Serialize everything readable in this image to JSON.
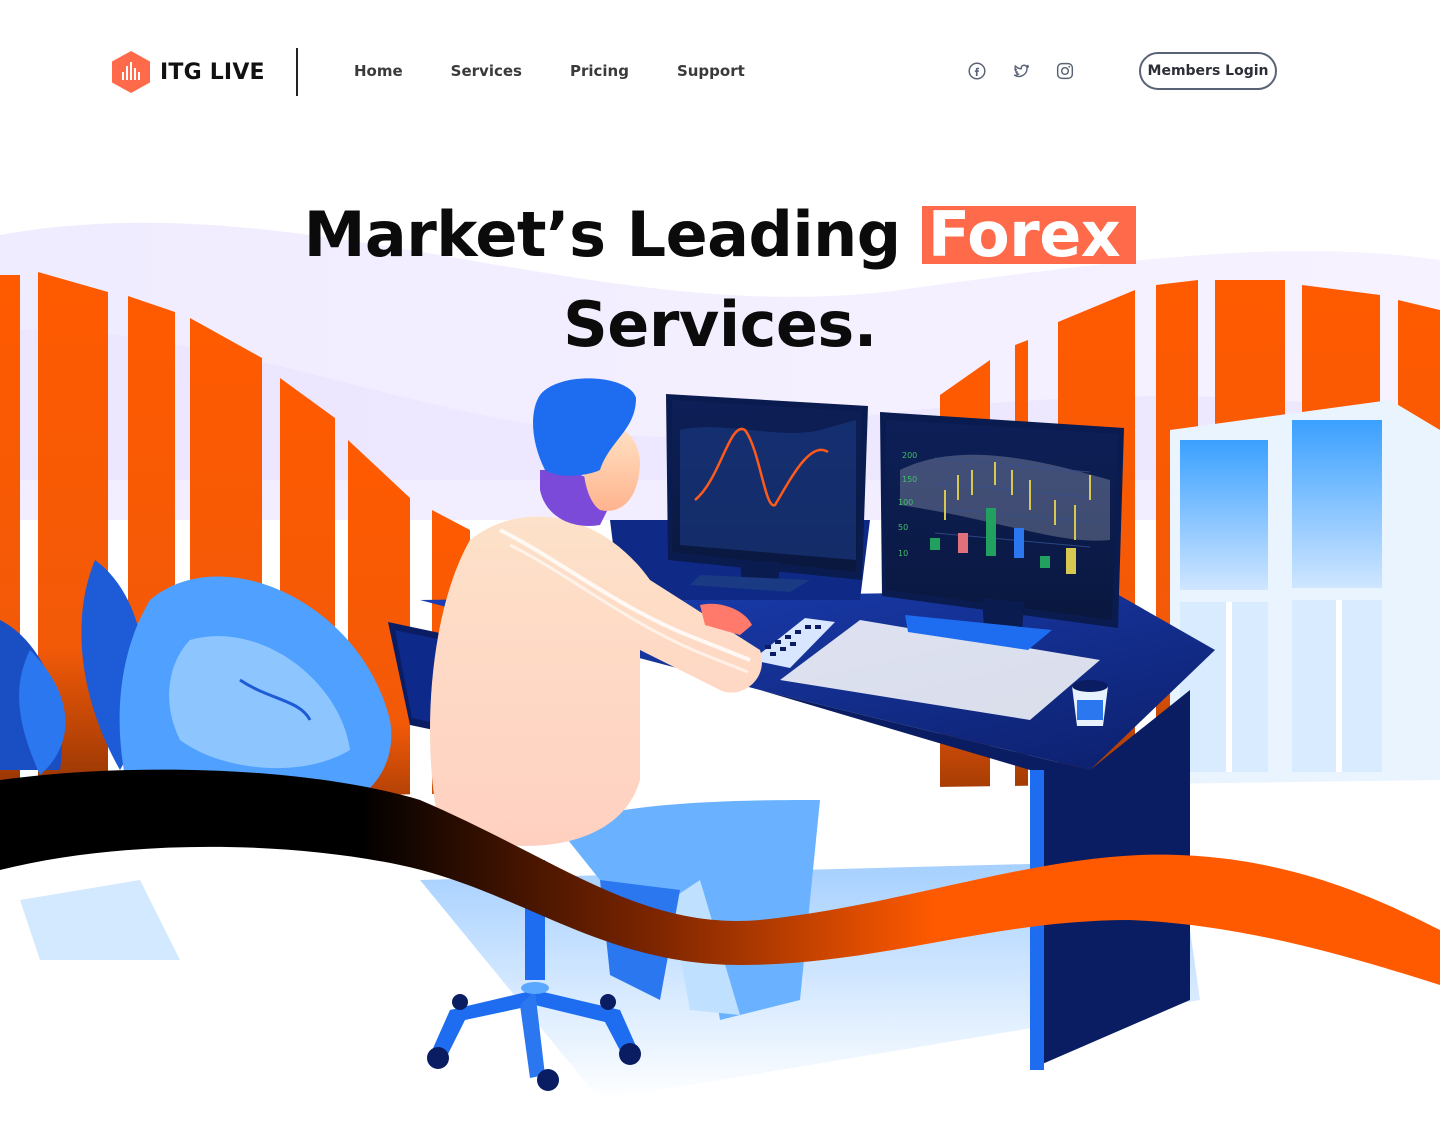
{
  "brand": {
    "name": "ITG LIVE",
    "logo_icon": "bars-hex-logo",
    "accent": "#ff6a4a"
  },
  "nav": {
    "items": [
      {
        "label": "Home"
      },
      {
        "label": "Services"
      },
      {
        "label": "Pricing"
      },
      {
        "label": "Support"
      }
    ]
  },
  "social": [
    {
      "icon": "facebook-icon"
    },
    {
      "icon": "twitter-icon"
    },
    {
      "icon": "instagram-icon"
    }
  ],
  "login": {
    "label": "Members Login"
  },
  "hero": {
    "title_before": "Market’s Leading",
    "title_highlight": "Forex",
    "title_line2": "Services."
  },
  "monitor_chart": {
    "y_ticks": [
      "200",
      "150",
      "100",
      "50",
      "10"
    ]
  },
  "colors": {
    "orange": "#ff5a00",
    "navy": "#0c1f6b",
    "blue": "#1e6cf0",
    "highlight": "#ff6a4a"
  }
}
